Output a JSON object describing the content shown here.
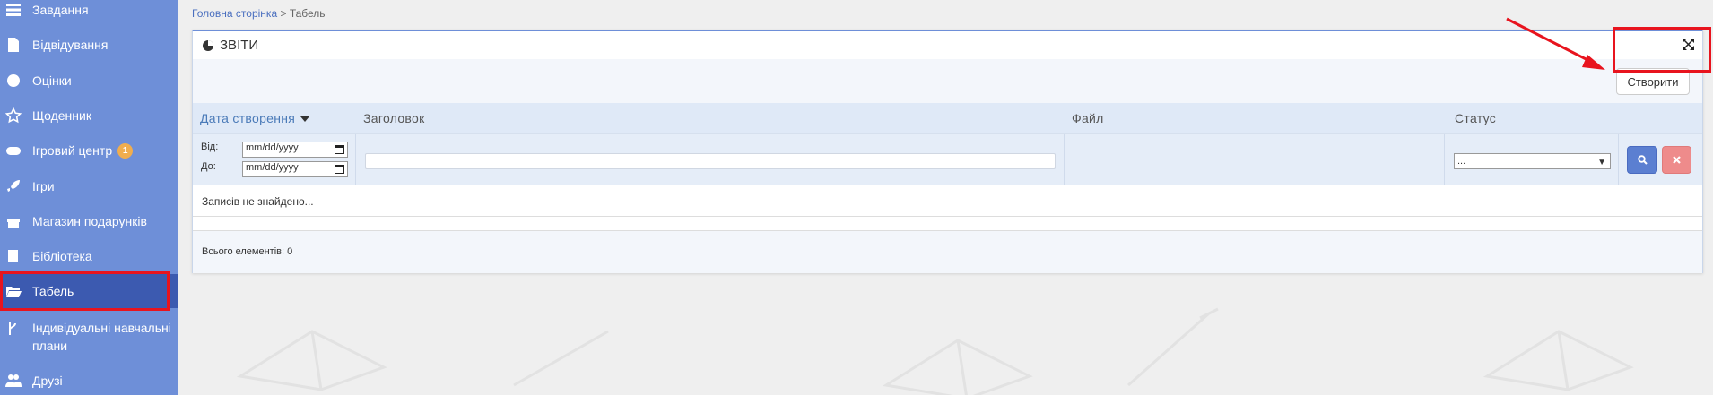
{
  "sidebar": {
    "items": [
      {
        "label": "Завдання",
        "icon": "list-icon"
      },
      {
        "label": "Відвідування",
        "icon": "document-icon"
      },
      {
        "label": "Оцінки",
        "icon": "badge-icon"
      },
      {
        "label": "Щоденник",
        "icon": "star-icon"
      },
      {
        "label": "Ігровий центр",
        "icon": "gamepad-icon",
        "badge": "1"
      },
      {
        "label": "Ігри",
        "icon": "rocket-icon"
      },
      {
        "label": "Магазин подарунків",
        "icon": "gift-icon"
      },
      {
        "label": "Бібліотека",
        "icon": "book-icon"
      },
      {
        "label": "Табель",
        "icon": "folder-open-icon",
        "active": true
      },
      {
        "label": "Індивідуальні навчальні плани",
        "icon": "branch-icon"
      },
      {
        "label": "Друзі",
        "icon": "users-icon"
      }
    ]
  },
  "breadcrumb": {
    "home": "Головна сторінка",
    "separator": ">",
    "current": "Табель"
  },
  "panel": {
    "title": "ЗВІТИ",
    "create_button": "Створити",
    "columns": {
      "date": "Дата створення",
      "title": "Заголовок",
      "file": "Файл",
      "status": "Статус"
    },
    "filters": {
      "from_label": "Від:",
      "to_label": "До:",
      "from_value": "mm/dd/yyyy",
      "to_value": "mm/dd/yyyy",
      "status_value": "..."
    },
    "empty_message": "Записів не знайдено...",
    "total_label": "Всього елементів: 0"
  },
  "colors": {
    "sidebar": "#6e8fd8",
    "active": "#3c5ab0",
    "highlight": "#e8141e",
    "accent": "#5b7fd1"
  }
}
